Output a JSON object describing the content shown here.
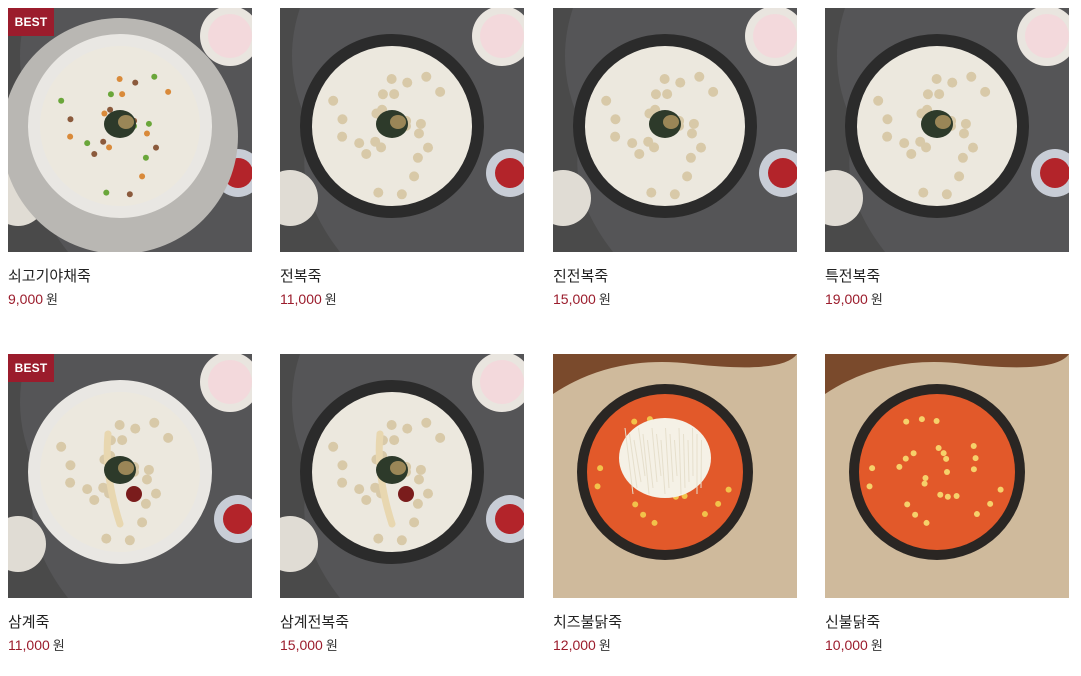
{
  "products": [
    {
      "name": "쇠고기야채죽",
      "price": "9,000",
      "currency": "원",
      "badge": "BEST",
      "variant": "veg"
    },
    {
      "name": "전복죽",
      "price": "11,000",
      "currency": "원",
      "badge": "",
      "variant": "abalone"
    },
    {
      "name": "진전복죽",
      "price": "15,000",
      "currency": "원",
      "badge": "",
      "variant": "abalone"
    },
    {
      "name": "특전복죽",
      "price": "19,000",
      "currency": "원",
      "badge": "",
      "variant": "abalone"
    },
    {
      "name": "삼계죽",
      "price": "11,000",
      "currency": "원",
      "badge": "BEST",
      "variant": "samgye"
    },
    {
      "name": "삼계전복죽",
      "price": "15,000",
      "currency": "원",
      "badge": "",
      "variant": "samgye-dark"
    },
    {
      "name": "치즈불닭죽",
      "price": "12,000",
      "currency": "원",
      "badge": "",
      "variant": "cheese"
    },
    {
      "name": "신불닭죽",
      "price": "10,000",
      "currency": "원",
      "badge": "",
      "variant": "spicy"
    }
  ],
  "colors": {
    "accent": "#9b1c2c"
  }
}
